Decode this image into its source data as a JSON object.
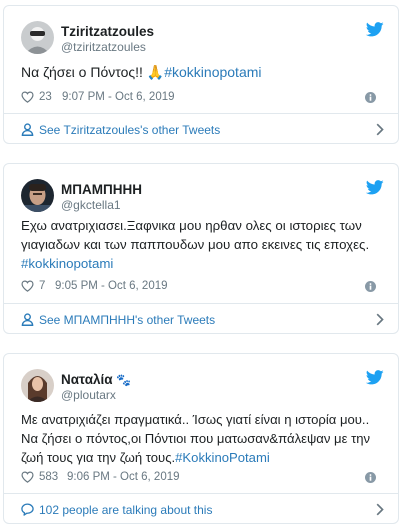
{
  "tweets": [
    {
      "name": "Tziritzatzoules",
      "handle": "@tziritzatzoules",
      "text_parts": [
        "Να ζήσει ο Πόντος!! ",
        "🙏",
        "#kokkinopotami"
      ],
      "likes": "23",
      "time": "9:07 PM - Oct 6, 2019",
      "footer": "See Tziritzatzoules's other Tweets"
    },
    {
      "name": "ΜΠΑΜΠΗΗΗ",
      "handle": "@gkctella1",
      "text_lines": [
        "Εχω ανατριχιασει.Ξαφνικα μου ηρθαν ολες οι ιστοριες των",
        "γιαγιαδων και των παππουδων μου απο εκεινες τις εποχες."
      ],
      "hashtag": "#kokkinopotami",
      "likes": "7",
      "time": "9:05 PM - Oct 6, 2019",
      "footer": "See ΜΠΑΜΠΗΗΗ's other Tweets"
    },
    {
      "name": "Ναταλία",
      "name_emoji": "🐾",
      "handle": "@ploutarx",
      "text_lines": [
        "Με ανατριχιάζει πραγματικά.. Ίσως γιατί είναι η ιστορία μου..",
        "Να ζήσει ο πόντος,οι Πόντιοι που ματωσαν&πάλεψαν με την"
      ],
      "text_line3": "ζωή τους για την ζωή τους.",
      "hashtag": "#KokkinoPotami",
      "likes": "583",
      "time": "9:06 PM - Oct 6, 2019",
      "footer": "102 people are talking about this"
    }
  ],
  "colors": {
    "link": "#2b7bb9",
    "twitter_blue": "#1da1f2",
    "muted": "#697882",
    "border": "#e1e8ed"
  },
  "icons": {
    "logo": "twitter-bird-icon",
    "like": "heart-icon",
    "info": "info-icon",
    "profile": "person-icon",
    "conversation": "comment-icon",
    "next": "chevron-right-icon"
  }
}
